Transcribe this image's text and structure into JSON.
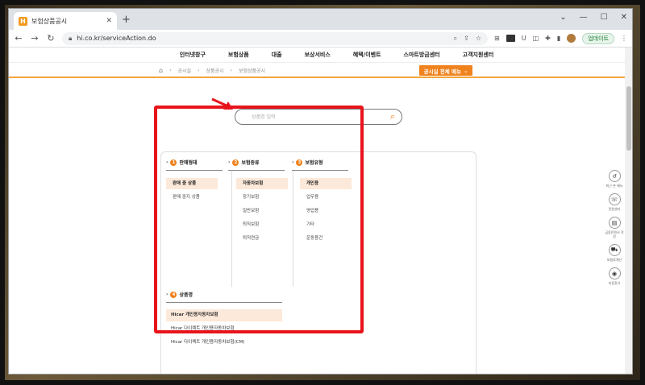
{
  "browser": {
    "tab_title": "보험상품공시",
    "favicon_letter": "H",
    "url": "hi.co.kr/serviceAction.do",
    "update_label": "업데이트"
  },
  "gnb": [
    "인터넷창구",
    "보험상품",
    "대출",
    "보상서비스",
    "혜택/이벤트",
    "스마트방금센터",
    "고객지원센터"
  ],
  "breadcrumb": [
    "공시실",
    "상품공시",
    "보험상품공시"
  ],
  "menu_button": "공시실 전체 메뉴",
  "search": {
    "placeholder": "상품명 입력"
  },
  "columns": [
    {
      "number": "1",
      "title": "판매형태",
      "options": [
        "판매 중 상품",
        "판매 중지 상품"
      ],
      "selected": 0
    },
    {
      "number": "2",
      "title": "보험종류",
      "options": [
        "자동차보험",
        "장기보험",
        "일반보험",
        "퇴직보험",
        "퇴직연금"
      ],
      "selected": 0
    },
    {
      "number": "3",
      "title": "보험유형",
      "options": [
        "개인용",
        "업무용",
        "영업용",
        "기타",
        "운동용건"
      ],
      "selected": 0
    }
  ],
  "products": {
    "number": "4",
    "title": "상품명",
    "items": [
      "Hicar 개인용자동차보험",
      "Hicar 다이렉트 개인용자동차보험",
      "Hicar 다이렉트 개인용자동차보험(CM)"
    ],
    "selected": 0
  },
  "quick_menu": [
    {
      "icon": "history-icon",
      "glyph": "↺",
      "label": "최근 본 메뉴"
    },
    {
      "icon": "chat-icon",
      "glyph": "☏",
      "label": "민원센터"
    },
    {
      "icon": "document-icon",
      "glyph": "▤",
      "label": "금융민원서 작성"
    },
    {
      "icon": "car-icon",
      "glyph": "⛟",
      "label": "보험료계산"
    },
    {
      "icon": "location-icon",
      "glyph": "◉",
      "label": "지점찾기"
    }
  ],
  "colors": {
    "accent": "#f0821e",
    "highlight": "#e8141b",
    "selected_bg": "#fde9d9"
  }
}
